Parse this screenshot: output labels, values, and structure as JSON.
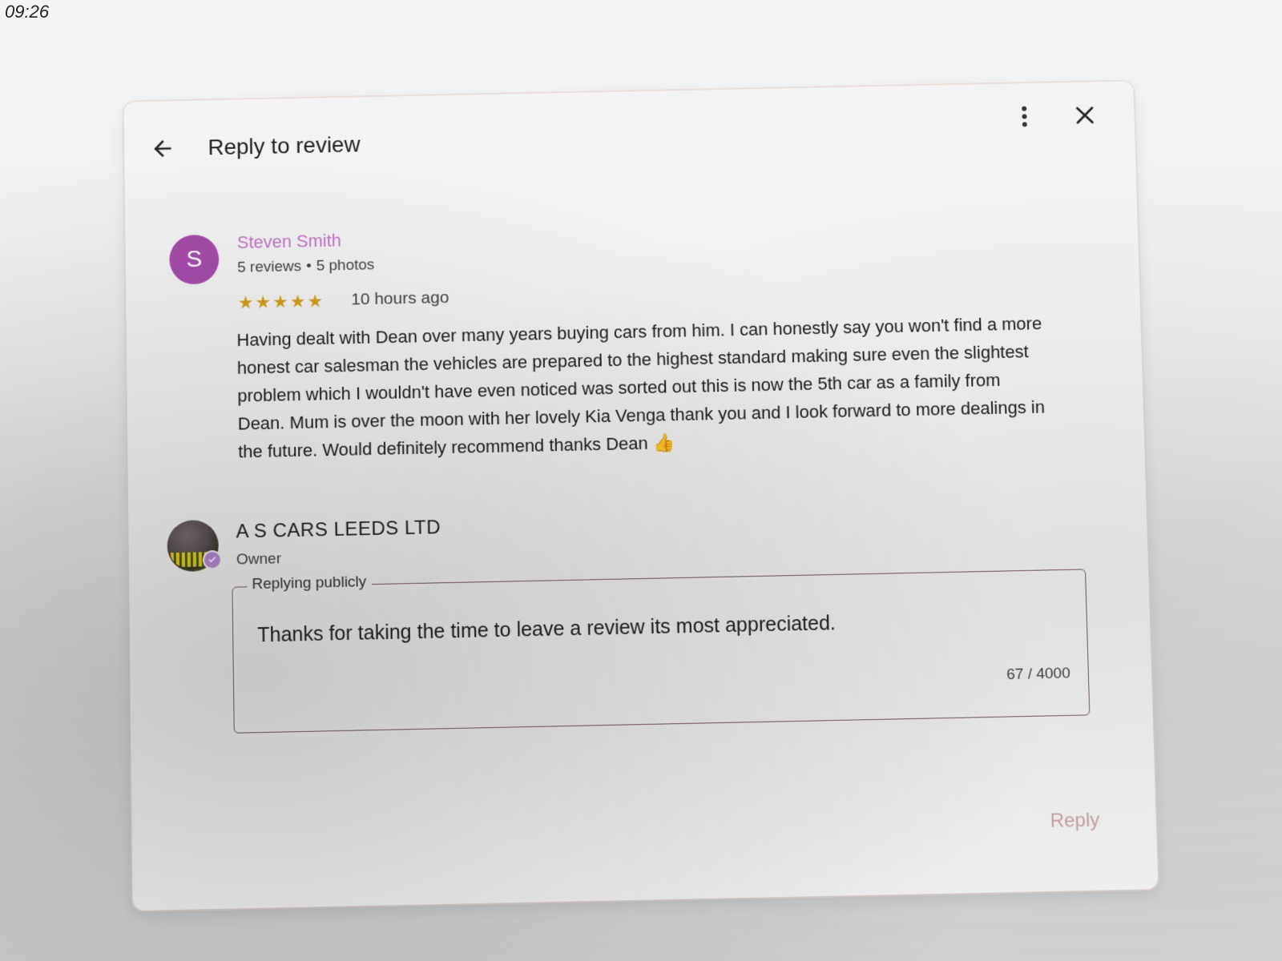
{
  "status_bar": {
    "time": "09:26"
  },
  "dialog": {
    "title": "Reply to review",
    "back_icon": "arrow-left-icon",
    "more_icon": "more-vert-icon",
    "close_icon": "close-icon"
  },
  "review": {
    "avatar_letter": "S",
    "avatar_color": "#a64dad",
    "reviewer_name": "Steven Smith",
    "reviews_count": "5 reviews",
    "separator": "•",
    "photos_count": "5 photos",
    "rating": 5,
    "max_rating": 5,
    "star_color": "#d4a017",
    "time_ago": "10 hours ago",
    "text": "Having dealt with Dean over many years buying cars from him. I can honestly say you won't find a more honest car salesman the vehicles are prepared to the highest standard making sure even the slightest problem which I wouldn't have even noticed was sorted out this is now the 5th car as a family from Dean. Mum is over the moon with her lovely Kia Venga thank you and I look forward to more dealings in the future. Would definitely recommend thanks Dean",
    "thumb_emoji": "👍"
  },
  "owner": {
    "name": "A S CARS LEEDS LTD",
    "role": "Owner"
  },
  "reply": {
    "label": "Replying publicly",
    "value": "Thanks for taking the time to leave a review its most appreciated.",
    "char_count": "67 / 4000"
  },
  "actions": {
    "reply_label": "Reply"
  }
}
